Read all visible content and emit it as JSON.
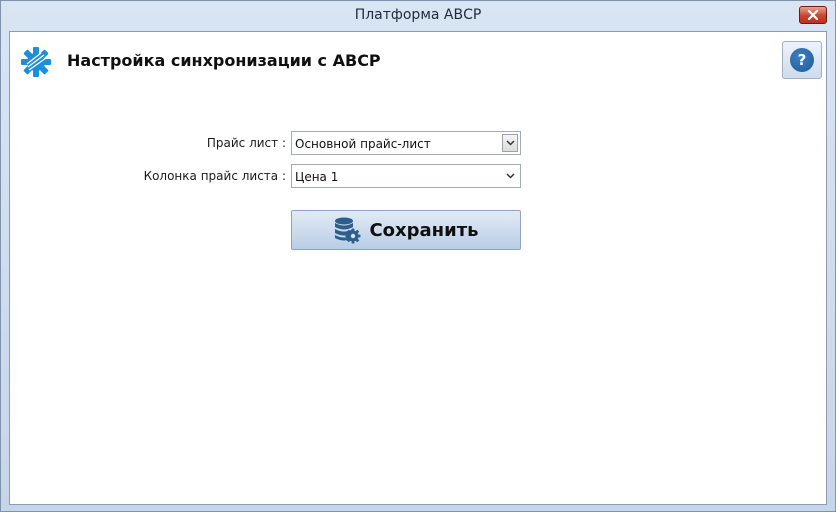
{
  "window": {
    "title": "Платформа АВСР",
    "close_icon": "close-icon"
  },
  "header": {
    "title": "Настройка синхронизации с АВСР",
    "logo_icon": "gear-logo-icon",
    "help_icon": "question-icon",
    "help_symbol": "?"
  },
  "form": {
    "price_list": {
      "label": "Прайс лист :",
      "selected": "Основной прайс-лист"
    },
    "price_column": {
      "label": "Колонка прайс листа :",
      "selected": "Цена 1"
    },
    "save": {
      "label": "Сохранить",
      "icon": "database-settings-icon"
    }
  },
  "colors": {
    "accent": "#1f5a96",
    "logo": "#1e8ed8",
    "button_bg": "#c9d9ee",
    "close": "#c7442d"
  }
}
